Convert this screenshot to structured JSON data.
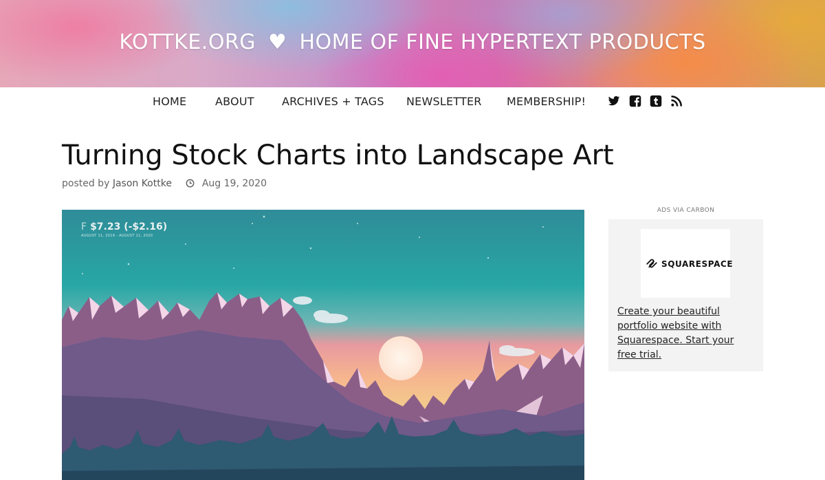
{
  "header": {
    "site_name": "KOTTKE.ORG",
    "heart": "♥",
    "tagline": "HOME OF FINE HYPERTEXT PRODUCTS"
  },
  "nav": {
    "items": [
      {
        "label": "HOME"
      },
      {
        "label": "ABOUT"
      },
      {
        "label": "ARCHIVES + TAGS"
      },
      {
        "label": "NEWSLETTER"
      },
      {
        "label": "MEMBERSHIP!"
      }
    ],
    "social_icons": [
      "twitter-icon",
      "facebook-icon",
      "tumblr-icon",
      "rss-icon"
    ]
  },
  "article": {
    "title": "Turning Stock Charts into Landscape Art",
    "posted_by_prefix": "posted by",
    "author": "Jason Kottke",
    "date": "Aug 19, 2020",
    "image": {
      "stock_symbol": "F",
      "stock_value": "$7.23 (-$2.16)",
      "date_range": "AUGUST 11, 2019 - AUGUST 11, 2020"
    }
  },
  "ad": {
    "label": "ADS VIA CARBON",
    "brand": "SQUARESPACE",
    "text": "Create your beautiful portfolio website with Squarespace. Start your free trial."
  },
  "colors": {
    "sky_top": "#2a8e9c",
    "sky_bottom": "#f5b39a",
    "mountain": "#8a5a84",
    "snow": "#f3d7e6",
    "foreground": "#5c4d78",
    "trees": "#2f5f73"
  }
}
